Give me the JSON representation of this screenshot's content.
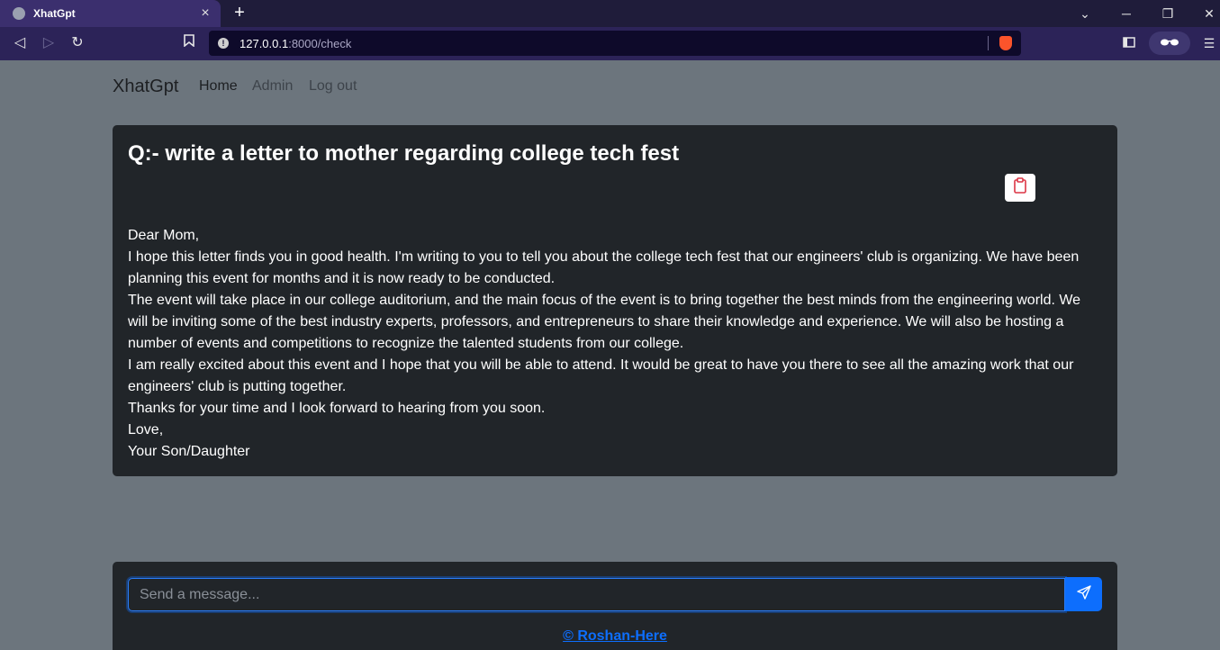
{
  "browser": {
    "tab_title": "XhatGpt",
    "tab_close": "×",
    "new_tab": "+",
    "url_host": "127.0.0.1",
    "url_path": ":8000/check"
  },
  "navbar": {
    "brand": "XhatGpt",
    "links": [
      "Home",
      "Admin",
      "Log out"
    ]
  },
  "chat": {
    "question": "Q:- write a letter to mother regarding college tech fest",
    "answer_lines": [
      "Dear Mom,",
      "I hope this letter finds you in good health. I'm writing to you to tell you about the college tech fest that our engineers' club is organizing. We have been planning this event for months and it is now ready to be conducted.",
      "The event will take place in our college auditorium, and the main focus of the event is to bring together the best minds from the engineering world. We will be inviting some of the best industry experts, professors, and entrepreneurs to share their knowledge and experience. We will also be hosting a number of events and competitions to recognize the talented students from our college.",
      "I am really excited about this event and I hope that you will be able to attend. It would be great to have you there to see all the amazing work that our engineers' club is putting together.",
      "Thanks for your time and I look forward to hearing from you soon.",
      "Love,",
      "Your Son/Daughter"
    ]
  },
  "composer": {
    "placeholder": "Send a message...",
    "value": ""
  },
  "footer": {
    "credit": "© Roshan-Here"
  },
  "colors": {
    "page_bg": "#6c757d",
    "card_bg": "#212529",
    "accent": "#0d6efd",
    "copy_icon": "#dc3545"
  }
}
